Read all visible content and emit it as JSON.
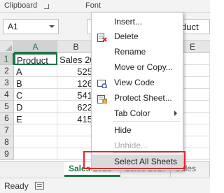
{
  "ribbon": {
    "groups": [
      "Clipboard",
      "Font"
    ]
  },
  "formula_bar": {
    "name_box": "A1",
    "content_fragment": "duct"
  },
  "sheet": {
    "columns": [
      "A",
      "B",
      "E"
    ],
    "rows": [
      {
        "num": "1",
        "a": "Product",
        "b": "Sales 201"
      },
      {
        "num": "2",
        "a": "A",
        "b": "525"
      },
      {
        "num": "3",
        "a": "B",
        "b": "126"
      },
      {
        "num": "4",
        "a": "C",
        "b": "541"
      },
      {
        "num": "5",
        "a": "D",
        "b": "622"
      },
      {
        "num": "6",
        "a": "E",
        "b": "415"
      },
      {
        "num": "7",
        "a": "",
        "b": ""
      },
      {
        "num": "8",
        "a": "",
        "b": ""
      },
      {
        "num": "9",
        "a": "",
        "b": ""
      }
    ]
  },
  "tabs": [
    "Sales 2018",
    "Sales 2017",
    "Sales"
  ],
  "status": {
    "text": "Ready"
  },
  "context_menu": {
    "items": [
      {
        "label": "Insert...",
        "icon": "",
        "enabled": true
      },
      {
        "label": "Delete",
        "icon": "delete-sheet-icon",
        "enabled": true
      },
      {
        "label": "Rename",
        "icon": "",
        "enabled": true
      },
      {
        "label": "Move or Copy...",
        "icon": "",
        "enabled": true
      },
      {
        "label": "View Code",
        "icon": "view-code-icon",
        "enabled": true
      },
      {
        "label": "Protect Sheet...",
        "icon": "protect-sheet-icon",
        "enabled": true
      },
      {
        "label": "Tab Color",
        "icon": "",
        "enabled": true,
        "submenu": true
      },
      {
        "label": "Hide",
        "icon": "",
        "enabled": true
      },
      {
        "label": "Unhide...",
        "icon": "",
        "enabled": false
      },
      {
        "label": "Select All Sheets",
        "icon": "",
        "enabled": true,
        "highlighted": true
      }
    ]
  },
  "colors": {
    "accent": "#217346",
    "highlight_border": "#e8252a"
  }
}
